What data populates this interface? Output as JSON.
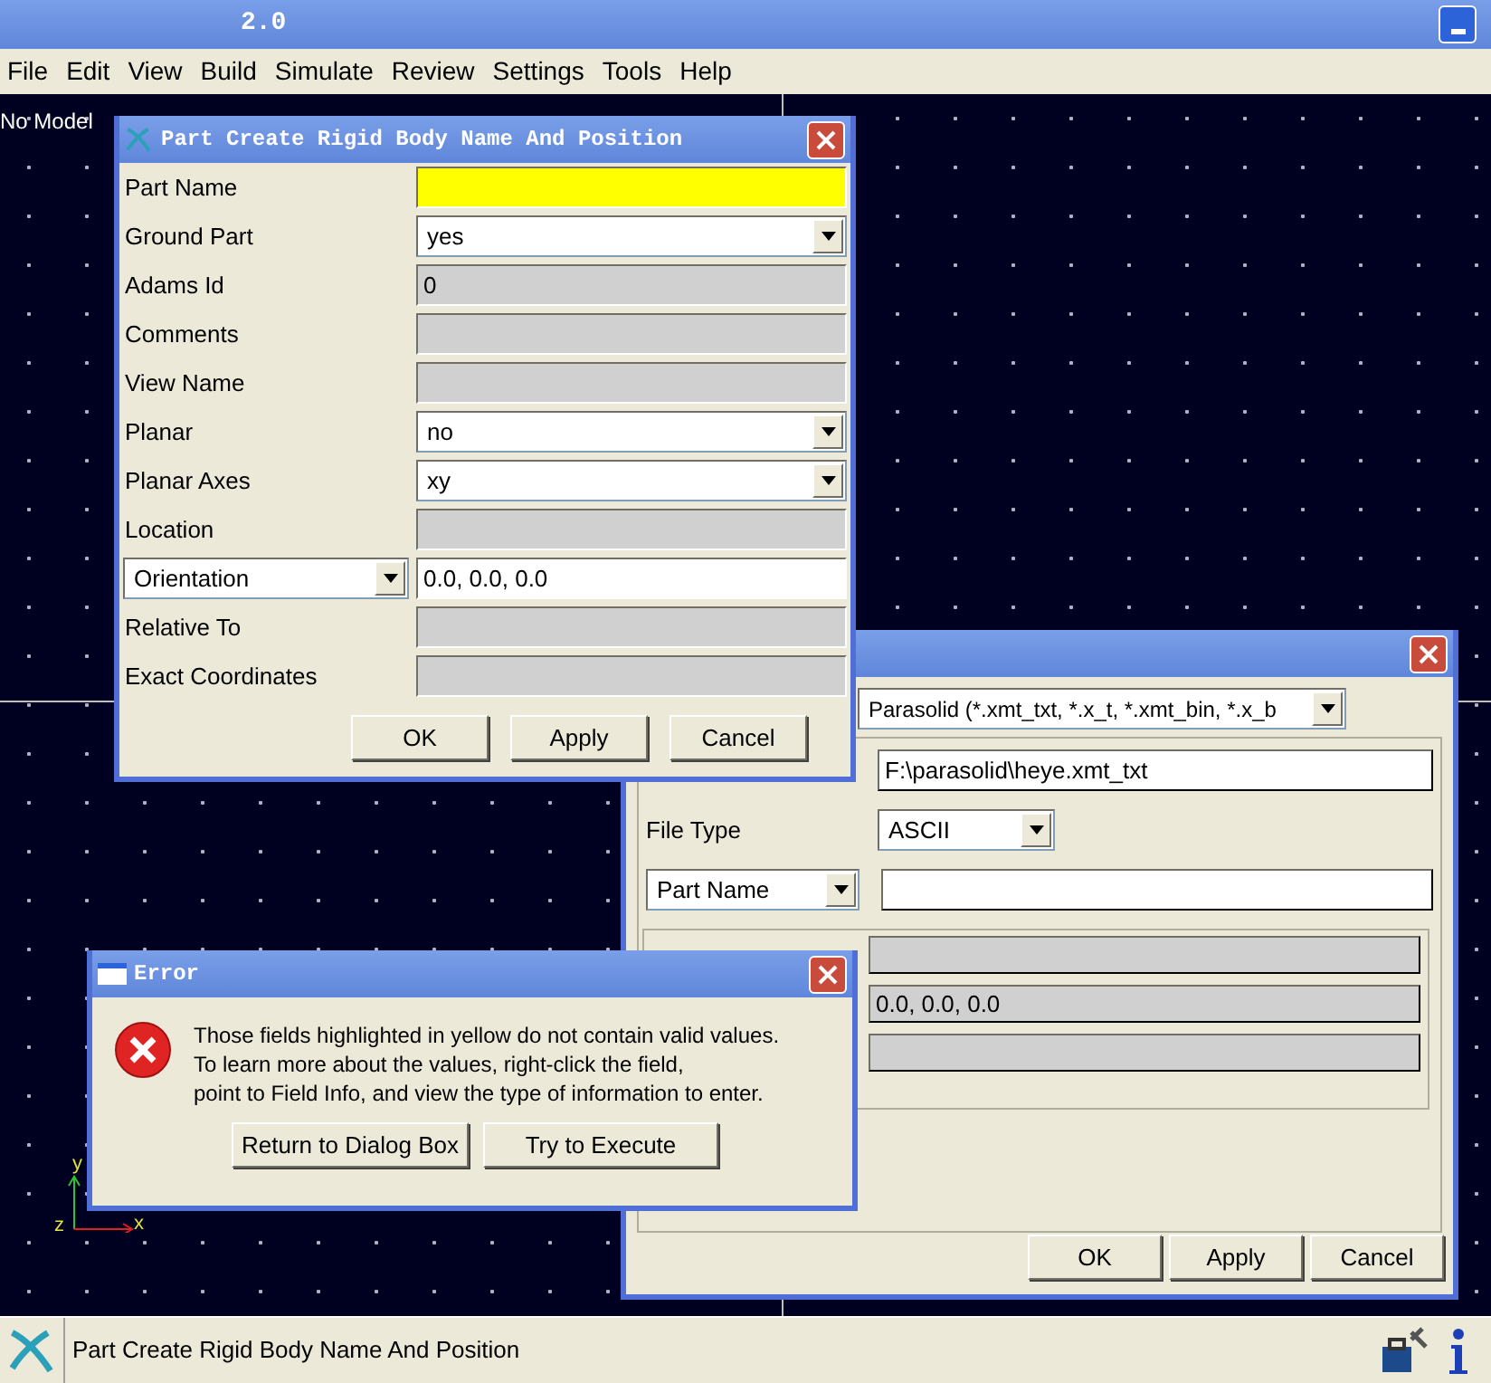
{
  "window": {
    "title": "2.0"
  },
  "menu": [
    "File",
    "Edit",
    "View",
    "Build",
    "Simulate",
    "Review",
    "Settings",
    "Tools",
    "Help"
  ],
  "canvas": {
    "label": "No Model",
    "axes": {
      "y": "y",
      "z": "z",
      "x": "x"
    }
  },
  "import_dialog": {
    "file_format": "Parasolid (*.xmt_txt, *.x_t, *.xmt_bin, *.x_b",
    "file_value": "F:\\parasolid\\heye.xmt_txt",
    "file_type_label": "File Type",
    "file_type": "ASCII",
    "name_selector": "Part Name",
    "group_fields": [
      {
        "kind": "display"
      },
      {
        "kind": "display",
        "value": "0.0, 0.0, 0.0"
      },
      {
        "kind": "display"
      }
    ],
    "buttons": [
      "OK",
      "Apply",
      "Cancel"
    ]
  },
  "part_dialog": {
    "title": "Part Create Rigid Body Name And Position",
    "rows": [
      {
        "label": "Part Name",
        "label_menu": false,
        "kind": "entry",
        "highlighted": true
      },
      {
        "label": "Ground Part",
        "label_menu": false,
        "kind": "choice",
        "value": "yes",
        "highlighted": false
      },
      {
        "label": "Adams Id",
        "label_menu": false,
        "kind": "display",
        "value": "0",
        "highlighted": false
      },
      {
        "label": "Comments",
        "label_menu": false,
        "kind": "display",
        "highlighted": false
      },
      {
        "label": "View Name",
        "label_menu": false,
        "kind": "display",
        "highlighted": false
      },
      {
        "label": "Planar",
        "label_menu": false,
        "kind": "choice",
        "value": "no",
        "highlighted": false
      },
      {
        "label": "Planar Axes",
        "label_menu": false,
        "kind": "choice",
        "value": "xy",
        "highlighted": false
      },
      {
        "label": "Location",
        "label_menu": false,
        "kind": "display",
        "highlighted": false
      },
      {
        "label": "Orientation",
        "label_menu": true,
        "kind": "entry",
        "value": "0.0, 0.0, 0.0",
        "highlighted": false
      },
      {
        "label": "Relative To",
        "label_menu": false,
        "kind": "display",
        "highlighted": false
      },
      {
        "label": "Exact Coordinates",
        "label_menu": false,
        "kind": "display",
        "highlighted": false
      }
    ],
    "buttons": [
      "OK",
      "Apply",
      "Cancel"
    ]
  },
  "error_dialog": {
    "title": "Error",
    "message": [
      "Those fields highlighted in yellow do not contain valid values.",
      "To learn more about the values, right-click the field,",
      "point to Field Info, and view the type of information to enter."
    ],
    "buttons": [
      "Return to Dialog Box",
      "Try to Execute"
    ]
  },
  "status_bar": {
    "text": "Part Create Rigid Body Name And Position"
  }
}
